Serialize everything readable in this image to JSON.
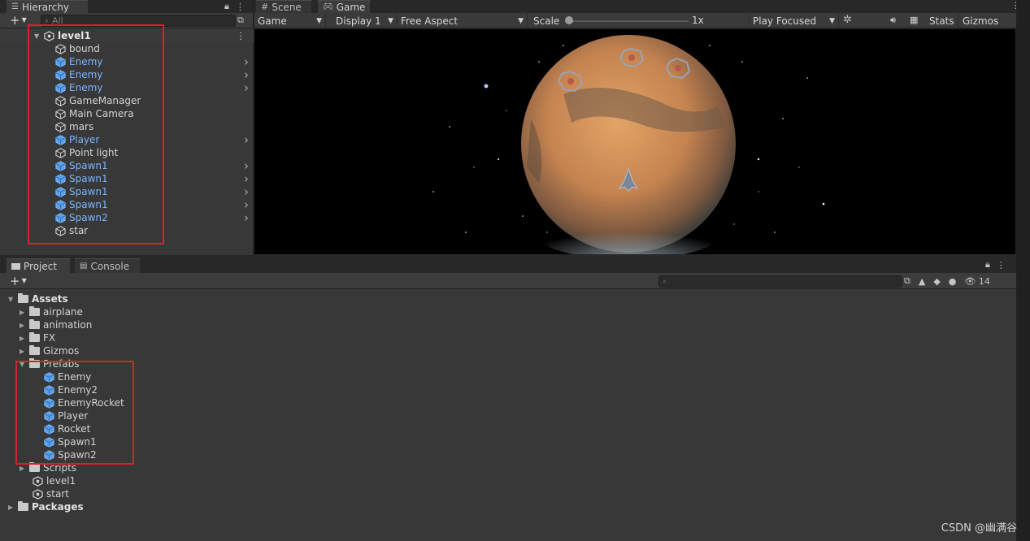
{
  "hierarchy": {
    "tab_title": "Hierarchy",
    "search_placeholder": "All",
    "root": "level1",
    "items": [
      {
        "label": "bound",
        "prefab": false,
        "has_children": false
      },
      {
        "label": "Enemy",
        "prefab": true,
        "has_children": true
      },
      {
        "label": "Enemy",
        "prefab": true,
        "has_children": true
      },
      {
        "label": "Enemy",
        "prefab": true,
        "has_children": true
      },
      {
        "label": "GameManager",
        "prefab": false,
        "has_children": false
      },
      {
        "label": "Main Camera",
        "prefab": false,
        "has_children": false
      },
      {
        "label": "mars",
        "prefab": false,
        "has_children": false
      },
      {
        "label": "Player",
        "prefab": true,
        "has_children": true
      },
      {
        "label": "Point light",
        "prefab": false,
        "has_children": false
      },
      {
        "label": "Spawn1",
        "prefab": true,
        "has_children": true
      },
      {
        "label": "Spawn1",
        "prefab": true,
        "has_children": true
      },
      {
        "label": "Spawn1",
        "prefab": true,
        "has_children": true
      },
      {
        "label": "Spawn1",
        "prefab": true,
        "has_children": true
      },
      {
        "label": "Spawn2",
        "prefab": true,
        "has_children": true
      },
      {
        "label": "star",
        "prefab": false,
        "has_children": false
      }
    ]
  },
  "scene_tab": "Scene",
  "game_tab": "Game",
  "game_toolbar": {
    "mode": "Game",
    "display": "Display 1",
    "aspect": "Free Aspect",
    "scale_label": "Scale",
    "scale_value": "1x",
    "play_mode": "Play Focused",
    "stats": "Stats",
    "gizmos": "Gizmos"
  },
  "project": {
    "tab_project": "Project",
    "tab_console": "Console",
    "hidden_count": "14",
    "tree": {
      "assets": "Assets",
      "folders": [
        "airplane",
        "animation",
        "FX",
        "Gizmos"
      ],
      "prefabs_folder": "Prefabs",
      "prefabs": [
        "Enemy",
        "Enemy2",
        "EnemyRocket",
        "Player",
        "Rocket",
        "Spawn1",
        "Spawn2"
      ],
      "scripts_folder": "Scripts",
      "scenes": [
        "level1",
        "start"
      ],
      "packages": "Packages"
    }
  },
  "watermark": "CSDN @幽满谷",
  "colors": {
    "prefab_blue": "#7ab4ff",
    "highlight_red": "#d8222a",
    "panel_bg": "#383838"
  }
}
